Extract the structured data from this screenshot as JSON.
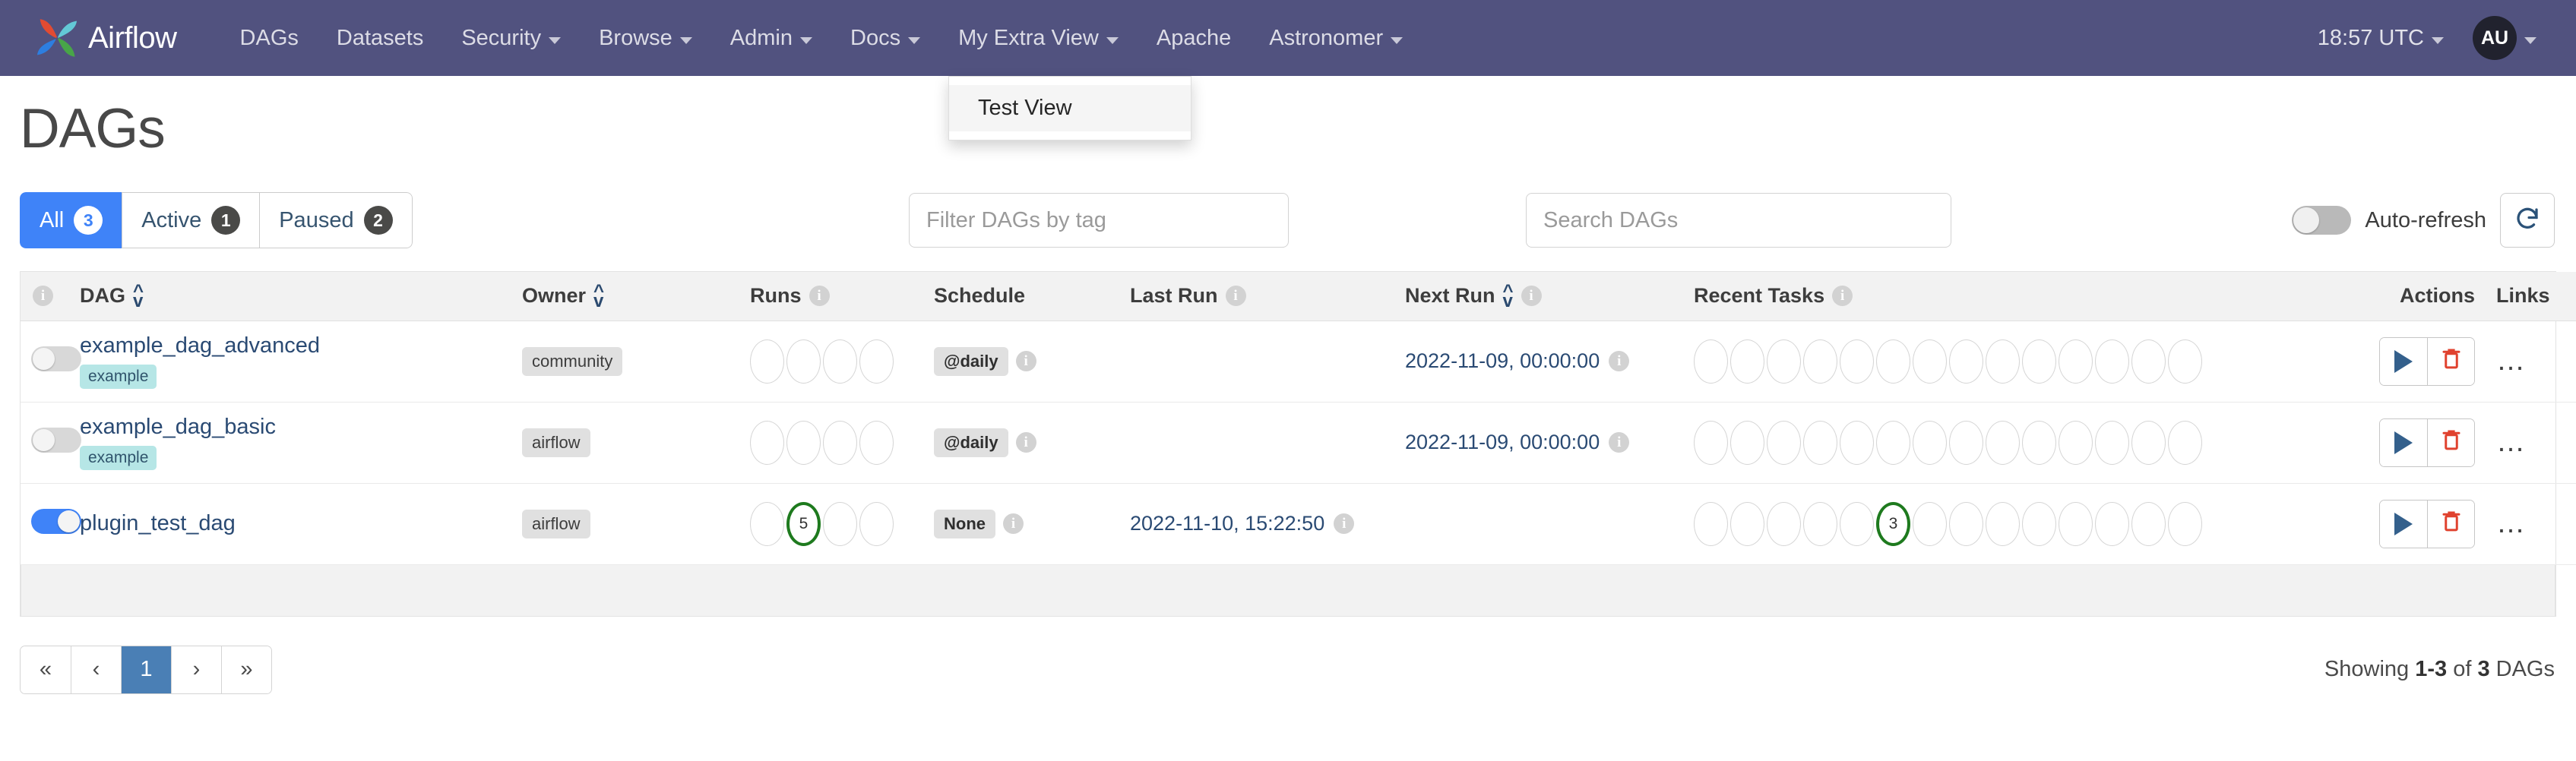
{
  "navbar": {
    "brand": "Airflow",
    "brand_icon": "airflow-pinwheel-logo",
    "items": [
      {
        "label": "DAGs",
        "has_caret": false
      },
      {
        "label": "Datasets",
        "has_caret": false
      },
      {
        "label": "Security",
        "has_caret": true
      },
      {
        "label": "Browse",
        "has_caret": true
      },
      {
        "label": "Admin",
        "has_caret": true
      },
      {
        "label": "Docs",
        "has_caret": true
      },
      {
        "label": "My Extra View",
        "has_caret": true
      },
      {
        "label": "Apache",
        "has_caret": false
      },
      {
        "label": "Astronomer",
        "has_caret": true
      }
    ],
    "clock": "18:57 UTC",
    "avatar_initials": "AU"
  },
  "dropdown": {
    "open_for": "My Extra View",
    "items": [
      "Test View"
    ]
  },
  "page": {
    "title": "DAGs"
  },
  "filters": {
    "buttons": [
      {
        "label": "All",
        "count": "3",
        "active": true
      },
      {
        "label": "Active",
        "count": "1",
        "active": false
      },
      {
        "label": "Paused",
        "count": "2",
        "active": false
      }
    ],
    "tag_placeholder": "Filter DAGs by tag",
    "tag_value": "",
    "search_placeholder": "Search DAGs",
    "search_value": "",
    "auto_refresh_label": "Auto-refresh",
    "auto_refresh_on": false,
    "refresh_icon": "refresh-icon"
  },
  "table": {
    "headers": [
      {
        "key": "info",
        "label": "",
        "info": true,
        "sortable": false
      },
      {
        "key": "dag",
        "label": "DAG",
        "info": false,
        "sortable": true
      },
      {
        "key": "owner",
        "label": "Owner",
        "info": false,
        "sortable": true
      },
      {
        "key": "runs",
        "label": "Runs",
        "info": true,
        "sortable": false
      },
      {
        "key": "schedule",
        "label": "Schedule",
        "info": false,
        "sortable": false
      },
      {
        "key": "last_run",
        "label": "Last Run",
        "info": true,
        "sortable": false
      },
      {
        "key": "next_run",
        "label": "Next Run",
        "info": true,
        "sortable": true
      },
      {
        "key": "recent_tasks",
        "label": "Recent Tasks",
        "info": true,
        "sortable": false
      },
      {
        "key": "actions",
        "label": "Actions",
        "info": false,
        "sortable": false
      },
      {
        "key": "links",
        "label": "Links",
        "info": false,
        "sortable": false
      }
    ],
    "rows": [
      {
        "paused_toggle_on": false,
        "name": "example_dag_advanced",
        "tags": [
          "example"
        ],
        "owner": "community",
        "runs": [
          {
            "count": "",
            "state": "none"
          },
          {
            "count": "",
            "state": "none"
          },
          {
            "count": "",
            "state": "none"
          },
          {
            "count": "",
            "state": "none"
          }
        ],
        "schedule": "@daily",
        "last_run": "",
        "next_run": "2022-11-09, 00:00:00",
        "recent_tasks": [
          {
            "count": "",
            "state": "none"
          },
          {
            "count": "",
            "state": "none"
          },
          {
            "count": "",
            "state": "none"
          },
          {
            "count": "",
            "state": "none"
          },
          {
            "count": "",
            "state": "none"
          },
          {
            "count": "",
            "state": "none"
          },
          {
            "count": "",
            "state": "none"
          },
          {
            "count": "",
            "state": "none"
          },
          {
            "count": "",
            "state": "none"
          },
          {
            "count": "",
            "state": "none"
          },
          {
            "count": "",
            "state": "none"
          },
          {
            "count": "",
            "state": "none"
          },
          {
            "count": "",
            "state": "none"
          },
          {
            "count": "",
            "state": "none"
          }
        ],
        "actions": [
          "trigger-dag",
          "delete-dag"
        ],
        "links": "…"
      },
      {
        "paused_toggle_on": false,
        "name": "example_dag_basic",
        "tags": [
          "example"
        ],
        "owner": "airflow",
        "runs": [
          {
            "count": "",
            "state": "none"
          },
          {
            "count": "",
            "state": "none"
          },
          {
            "count": "",
            "state": "none"
          },
          {
            "count": "",
            "state": "none"
          }
        ],
        "schedule": "@daily",
        "last_run": "",
        "next_run": "2022-11-09, 00:00:00",
        "recent_tasks": [
          {
            "count": "",
            "state": "none"
          },
          {
            "count": "",
            "state": "none"
          },
          {
            "count": "",
            "state": "none"
          },
          {
            "count": "",
            "state": "none"
          },
          {
            "count": "",
            "state": "none"
          },
          {
            "count": "",
            "state": "none"
          },
          {
            "count": "",
            "state": "none"
          },
          {
            "count": "",
            "state": "none"
          },
          {
            "count": "",
            "state": "none"
          },
          {
            "count": "",
            "state": "none"
          },
          {
            "count": "",
            "state": "none"
          },
          {
            "count": "",
            "state": "none"
          },
          {
            "count": "",
            "state": "none"
          },
          {
            "count": "",
            "state": "none"
          }
        ],
        "actions": [
          "trigger-dag",
          "delete-dag"
        ],
        "links": "…"
      },
      {
        "paused_toggle_on": true,
        "name": "plugin_test_dag",
        "tags": [],
        "owner": "airflow",
        "runs": [
          {
            "count": "",
            "state": "none"
          },
          {
            "count": "5",
            "state": "success"
          },
          {
            "count": "",
            "state": "none"
          },
          {
            "count": "",
            "state": "none"
          }
        ],
        "schedule": "None",
        "last_run": "2022-11-10, 15:22:50",
        "next_run": "",
        "recent_tasks": [
          {
            "count": "",
            "state": "none"
          },
          {
            "count": "",
            "state": "none"
          },
          {
            "count": "",
            "state": "none"
          },
          {
            "count": "",
            "state": "none"
          },
          {
            "count": "",
            "state": "none"
          },
          {
            "count": "3",
            "state": "success"
          },
          {
            "count": "",
            "state": "none"
          },
          {
            "count": "",
            "state": "none"
          },
          {
            "count": "",
            "state": "none"
          },
          {
            "count": "",
            "state": "none"
          },
          {
            "count": "",
            "state": "none"
          },
          {
            "count": "",
            "state": "none"
          },
          {
            "count": "",
            "state": "none"
          },
          {
            "count": "",
            "state": "none"
          }
        ],
        "actions": [
          "trigger-dag",
          "delete-dag"
        ],
        "links": "…"
      }
    ]
  },
  "footer": {
    "pager": [
      {
        "label": "«",
        "name": "first-page",
        "current": false
      },
      {
        "label": "‹",
        "name": "prev-page",
        "current": false
      },
      {
        "label": "1",
        "name": "page-1",
        "current": true
      },
      {
        "label": "›",
        "name": "next-page",
        "current": false
      },
      {
        "label": "»",
        "name": "last-page",
        "current": false
      }
    ],
    "showing_prefix": "Showing ",
    "showing_range": "1-3",
    "showing_mid": " of ",
    "showing_total": "3",
    "showing_suffix": " DAGs"
  },
  "colors": {
    "navbar_bg": "#51527f",
    "accent_blue": "#3f83f8",
    "link_blue": "#2a4a73",
    "success_green": "#1e7a1e",
    "delete_red": "#e0422f"
  }
}
